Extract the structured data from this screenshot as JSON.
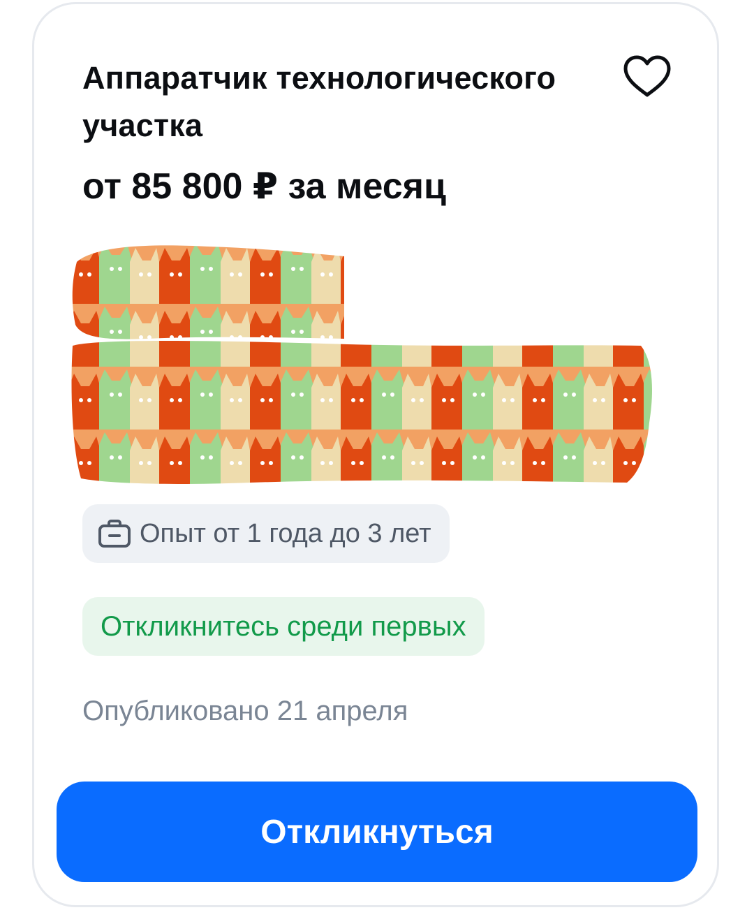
{
  "vacancy": {
    "title": "Аппаратчик технологического участка",
    "salary": "от 85 800 ₽ за месяц",
    "experience": "Опыт от 1 года до 3 лет",
    "experience_icon": "briefcase-icon",
    "response_hint": "Откликнитесь среди первых",
    "published": "Опубликовано 21 апреля",
    "favorite_icon": "heart-outline-icon",
    "respond_label": "Откликнуться"
  },
  "colors": {
    "accent": "#0a6cff",
    "hint_text": "#129a4a",
    "hint_bg": "#e8f6ec",
    "chip_bg": "#eef1f5",
    "muted_text": "#7a8594"
  }
}
